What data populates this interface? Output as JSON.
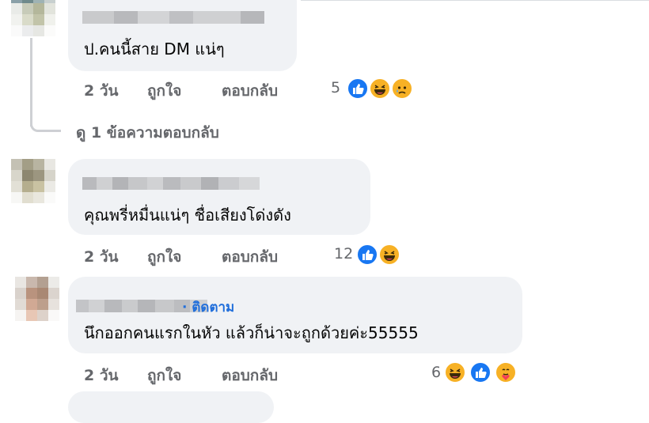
{
  "comments": [
    {
      "text": "ป.คนนี้สาย DM แน่ๆ",
      "time": "2 วัน",
      "like": "ถูกใจ",
      "reply": "ตอบกลับ",
      "reaction_count": "5",
      "reactions": [
        "like-icon",
        "haha-icon",
        "sad-icon"
      ],
      "view_replies": "ดู 1 ข้อความตอบกลับ"
    },
    {
      "text": "คุณพรี่หมื่นแน่ๆ ชื่อเสียงโด่งดัง",
      "time": "2 วัน",
      "like": "ถูกใจ",
      "reply": "ตอบกลับ",
      "reaction_count": "12",
      "reactions": [
        "like-icon",
        "haha-icon"
      ]
    },
    {
      "follow": "· ติดตาม",
      "text": "นึกออกคนแรกในหัว แล้วก็น่าจะถูกด้วยค่ะ55555",
      "time": "2 วัน",
      "like": "ถูกใจ",
      "reply": "ตอบกลับ",
      "reaction_count": "6",
      "reactions": [
        "haha-icon",
        "like-icon",
        "care-icon"
      ]
    }
  ],
  "colors": {
    "bubble": "#f0f2f5",
    "meta": "#65676b",
    "link": "#216fdb",
    "like": "#1877f2",
    "emoji": "#f7b125"
  }
}
